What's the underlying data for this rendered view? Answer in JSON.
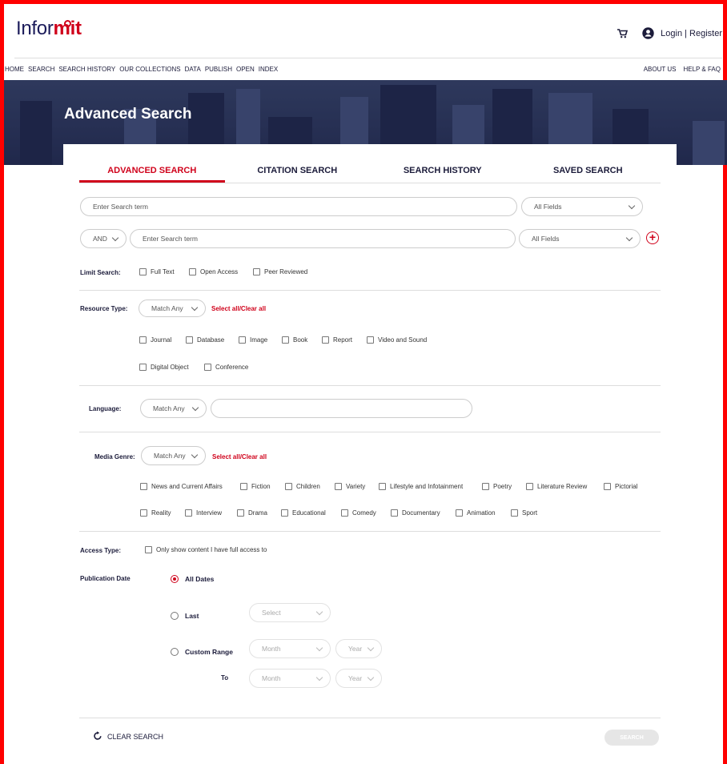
{
  "logo": {
    "prefix": "Infor",
    "suffix": "mit"
  },
  "header": {
    "login_label": "Login | Register"
  },
  "nav": {
    "left": [
      "HOME",
      "SEARCH",
      "SEARCH HISTORY",
      "OUR COLLECTIONS",
      "DATA",
      "PUBLISH",
      "OPEN",
      "INDEX"
    ],
    "right": [
      "ABOUT US",
      "HELP & FAQ"
    ]
  },
  "hero": {
    "title": "Advanced Search"
  },
  "tabs": [
    "ADVANCED SEARCH",
    "CITATION SEARCH",
    "SEARCH HISTORY",
    "SAVED SEARCH"
  ],
  "search": {
    "row1_placeholder": "Enter Search term",
    "row1_field": "All Fields",
    "row2_operator": "AND",
    "row2_placeholder": "Enter Search term",
    "row2_field": "All Fields"
  },
  "limit": {
    "label": "Limit Search:",
    "options": [
      "Full Text",
      "Open Access",
      "Peer Reviewed"
    ]
  },
  "resource": {
    "label": "Resource Type:",
    "match": "Match Any",
    "select_all": "Select all/Clear all",
    "row1": [
      "Journal",
      "Database",
      "Image",
      "Book",
      "Report",
      "Video and Sound"
    ],
    "row2": [
      "Digital Object",
      "Conference"
    ]
  },
  "language": {
    "label": "Language:",
    "match": "Match Any"
  },
  "media": {
    "label": "Media Genre:",
    "match": "Match Any",
    "select_all": "Select all/Clear all",
    "row1": [
      "News and Current Affairs",
      "Fiction",
      "Children",
      "Variety",
      "Lifestyle and Infotainment",
      "Poetry",
      "Literature Review",
      "Pictorial"
    ],
    "row2": [
      "Reality",
      "Interview",
      "Drama",
      "Educational",
      "Comedy",
      "Documentary",
      "Animation",
      "Sport"
    ]
  },
  "access": {
    "label": "Access Type:",
    "option": "Only show content I have full access to"
  },
  "pubdate": {
    "label": "Publication Date",
    "all_dates": "All Dates",
    "last": "Last",
    "last_select": "Select",
    "custom": "Custom Range",
    "to": "To",
    "month": "Month",
    "year": "Year"
  },
  "footer": {
    "clear": "CLEAR SEARCH",
    "search": "SEARCH"
  },
  "colors": {
    "accent": "#d0021b",
    "navy": "#1b1b3a"
  }
}
